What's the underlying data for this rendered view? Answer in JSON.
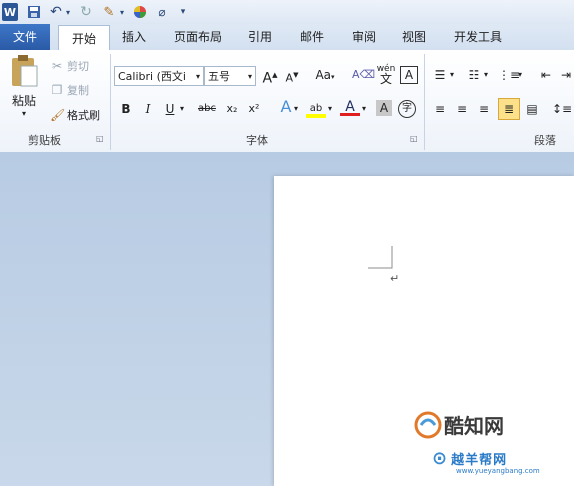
{
  "qat": {
    "app_icon": "W",
    "save_icon": "save-icon",
    "undo_icon": "undo-icon",
    "redo_icon": "redo-icon",
    "customize_icon": "customize-qat-icon"
  },
  "tabs": [
    {
      "label": "文件"
    },
    {
      "label": "开始"
    },
    {
      "label": "插入"
    },
    {
      "label": "页面布局"
    },
    {
      "label": "引用"
    },
    {
      "label": "邮件"
    },
    {
      "label": "审阅"
    },
    {
      "label": "视图"
    },
    {
      "label": "开发工具"
    }
  ],
  "clipboard": {
    "paste": "粘贴",
    "cut": "剪切",
    "copy": "复制",
    "format_painter": "格式刷",
    "group": "剪贴板"
  },
  "font": {
    "name": "Calibri (西文i",
    "size": "五号",
    "group": "字体",
    "bold": "B",
    "italic": "I",
    "underline": "U",
    "strike": "abc",
    "sub": "x₂",
    "sup": "x²",
    "grow": "A",
    "shrink": "A",
    "case": "Aa",
    "phonetic": "wén",
    "char_border": "A",
    "char_shade": "A",
    "enclose": "字"
  },
  "paragraph": {
    "group": "段落"
  },
  "colors": {
    "accent": "#2a5aa6",
    "highlight": "#ffff00",
    "font_red": "#e02020"
  },
  "watermark": {
    "brand1": "酷知网",
    "brand2": "越羊帮网",
    "url": "www.yueyangbang.com"
  }
}
